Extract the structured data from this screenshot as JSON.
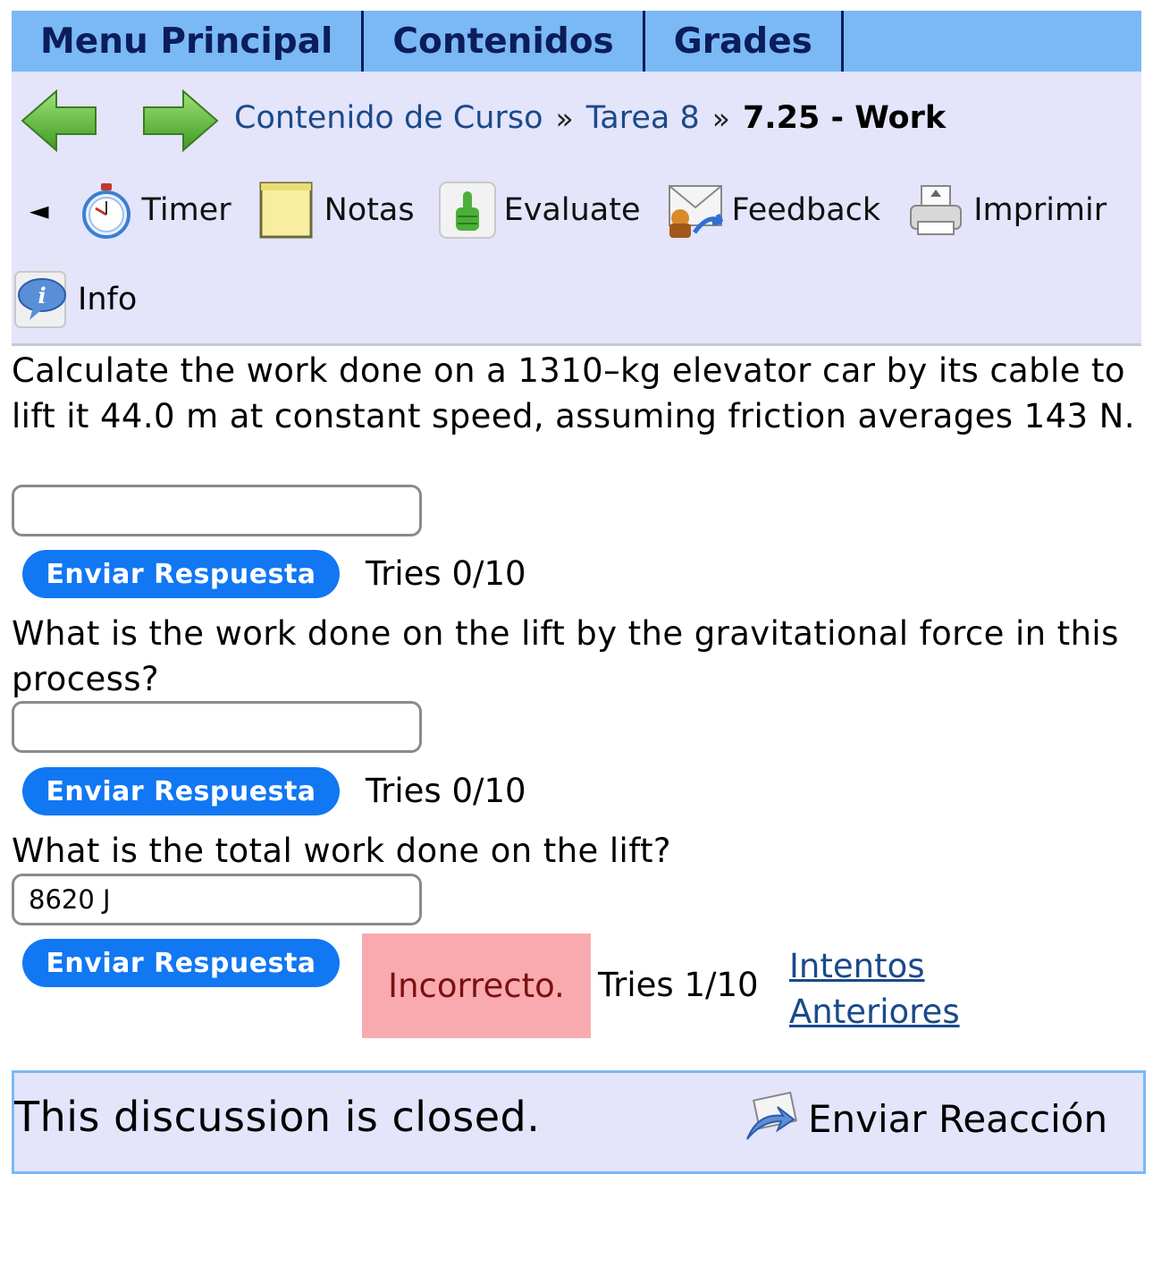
{
  "topnav": {
    "items": [
      {
        "label": "Menu Principal"
      },
      {
        "label": "Contenidos"
      },
      {
        "label": "Grades"
      }
    ]
  },
  "breadcrumb": {
    "items": [
      "Contenido de Curso",
      "Tarea 8"
    ],
    "separator": "»",
    "current": "7.25 - Work"
  },
  "tools": {
    "collapse_glyph": "◄",
    "timer": "Timer",
    "notes": "Notas",
    "evaluate": "Evaluate",
    "feedback": "Feedback",
    "print": "Imprimir",
    "info": "Info"
  },
  "questions": [
    {
      "text": "Calculate the work done on a 1310–kg elevator car by its cable to lift it 44.0 m at constant speed, assuming friction averages 143 N.",
      "answer_value": "",
      "submit_label": "Enviar Respuesta",
      "tries": "Tries 0/10"
    },
    {
      "text": "What is the work done on the lift by the gravitational force in this process?",
      "answer_value": "",
      "submit_label": "Enviar Respuesta",
      "tries": "Tries 0/10"
    },
    {
      "text": "What is the total work done on the lift?",
      "answer_value": "8620 J",
      "submit_label": "Enviar Respuesta",
      "status": "Incorrecto.",
      "tries": "Tries 1/10",
      "previous_attempts_link": "Intentos Anteriores"
    }
  ],
  "discussion": {
    "closed_text": "This discussion is closed.",
    "reaction_label": "Enviar Reacción"
  },
  "colors": {
    "nav_bg": "#7ab9f5",
    "toolbar_bg": "#e4e4fb",
    "button_bg": "#1177f2",
    "incorrect_bg": "#f9aaaf",
    "link": "#1a4a8a"
  }
}
